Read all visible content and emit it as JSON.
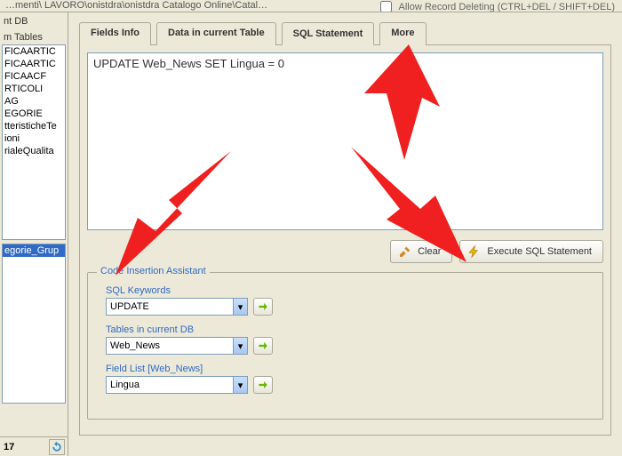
{
  "top": {
    "path_partial": "…menti\\ LAVORO\\onistdra\\onistdra Catalogo Online\\Catal…",
    "allow_delete_label": "Allow Record Deleting (CTRL+DEL / SHIFT+DEL)"
  },
  "left": {
    "nt_db_label": "nt DB",
    "tables_label": "m Tables",
    "items1": [
      "FICAARTIC",
      "FICAARTIC",
      "FICAACF",
      "RTICOLI",
      "AG",
      "EGORIE",
      "tteristicheTe",
      "ioni",
      "rialeQualita"
    ],
    "item_selected": "egorie_Grup",
    "count": "17"
  },
  "tabs": {
    "fields": "Fields Info",
    "data": "Data in current Table",
    "sql": "SQL Statement",
    "more": "More"
  },
  "sql_text": "UPDATE Web_News SET Lingua = 0",
  "buttons": {
    "clear": "Clear",
    "exec": "Execute SQL Statement"
  },
  "group": {
    "legend": "Code Insertion Assistant",
    "keywords_label": "SQL Keywords",
    "keywords_value": "UPDATE",
    "tables_label": "Tables in current DB",
    "tables_value": "Web_News",
    "fields_label": "Field List [Web_News]",
    "fields_value": "Lingua"
  }
}
